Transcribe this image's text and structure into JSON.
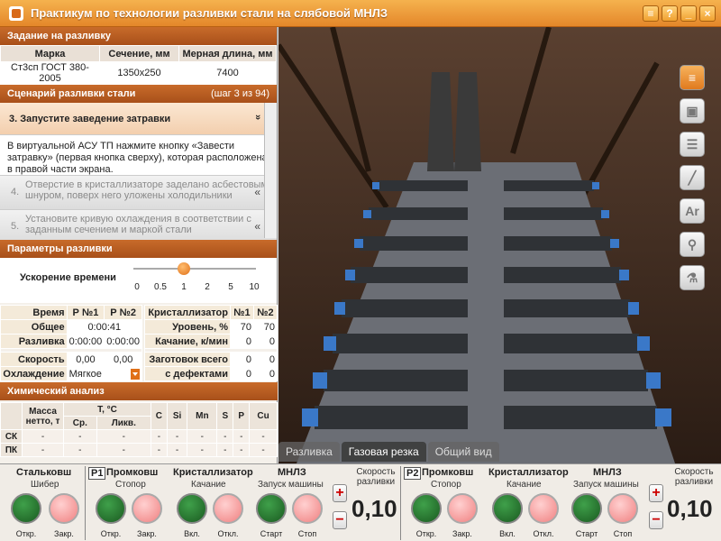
{
  "window": {
    "title": "Практикум по технологии разливки стали на слябовой МНЛЗ",
    "buttons": [
      "≡",
      "?",
      "_",
      "×"
    ]
  },
  "task": {
    "header": "Задание на разливку",
    "cols": [
      "Марка",
      "Сечение, мм",
      "Мерная длина, мм"
    ],
    "values": [
      "Ст3сп ГОСТ 380-2005",
      "1350x250",
      "7400"
    ]
  },
  "scenario": {
    "header": "Сценарий разливки стали",
    "step": "(шаг 3 из 94)",
    "active": {
      "label": "3. Запустите заведение затравки",
      "chevron": "»"
    },
    "desc": "В виртуальной АСУ ТП нажмите кнопку «Завести затравку» (первая кнопка сверху), которая расположена в правой части экрана.",
    "items": [
      {
        "n": "4.",
        "text": "Отверстие в кристаллизаторе заделано асбестовым шнуром, поверх него уложены холодильники",
        "chevron": "«"
      },
      {
        "n": "5.",
        "text": "Установите кривую охлаждения в соответствии с заданным сечением и маркой стали",
        "chevron": "«"
      }
    ]
  },
  "params": {
    "header": "Параметры разливки",
    "speed_label": "Ускорение времени",
    "ticks": [
      "0",
      "0.5",
      "1",
      "2",
      "5",
      "10"
    ],
    "time_col": "Время",
    "p1": "Р №1",
    "p2": "Р №2",
    "total": "Общее",
    "total_v": "0:00:41",
    "cast": "Разливка",
    "cast_v1": "0:00:00",
    "cast_v2": "0:00:00",
    "speed": "Скорость",
    "speed_v1": "0,00",
    "speed_v2": "0,00",
    "cool": "Охлаждение",
    "cool_v": "Мягкое",
    "cryst": "Кристаллизатор",
    "n1": "№1",
    "n2": "№2",
    "level": "Уровень, %",
    "level_v1": "70",
    "level_v2": "70",
    "swing": "Качание, к/мин",
    "swing_v1": "0",
    "swing_v2": "0",
    "blanks": "Заготовок всего",
    "blanks_v1": "0",
    "blanks_v2": "0",
    "defects": "с дефектами",
    "defects_v1": "0",
    "defects_v2": "0"
  },
  "chem": {
    "header": "Химический анализ",
    "mass": "Масса нетто, т",
    "temp": "T, °C",
    "avg": "Ср.",
    "liq": "Ликв.",
    "elements": [
      "C",
      "Si",
      "Mn",
      "S",
      "P",
      "Cu"
    ],
    "rows": [
      {
        "name": "СК",
        "cells": [
          "-",
          "-",
          "-",
          "-",
          "-",
          "-",
          "-",
          "-",
          "-"
        ]
      },
      {
        "name": "ПК",
        "cells": [
          "-",
          "-",
          "-",
          "-",
          "-",
          "-",
          "-",
          "-",
          "-"
        ]
      }
    ]
  },
  "sidebar": {
    "icons": [
      "guide-bar-icon",
      "ladle-icon",
      "rolls-icon",
      "torch-icon",
      "argon-icon",
      "probe-icon",
      "flask-icon"
    ],
    "ar": "Ar"
  },
  "tabs": [
    "Разливка",
    "Газовая резка",
    "Общий вид"
  ],
  "bottom": {
    "ladle": "Стальковш",
    "gate": "Шибер",
    "open": "Откр.",
    "close": "Закр.",
    "p1": "Р1",
    "p2": "Р2",
    "tundish": "Промковш",
    "stopper": "Стопор",
    "cryst": "Кристаллизатор",
    "swing": "Качание",
    "on": "Вкл.",
    "off": "Откл.",
    "mnlz": "МНЛЗ",
    "start_machine": "Запуск машины",
    "start": "Старт",
    "stop": "Стоп",
    "cast_speed": "Скорость разливки",
    "plus": "+",
    "minus": "−",
    "speed1": "0,10",
    "speed2": "0,10"
  }
}
